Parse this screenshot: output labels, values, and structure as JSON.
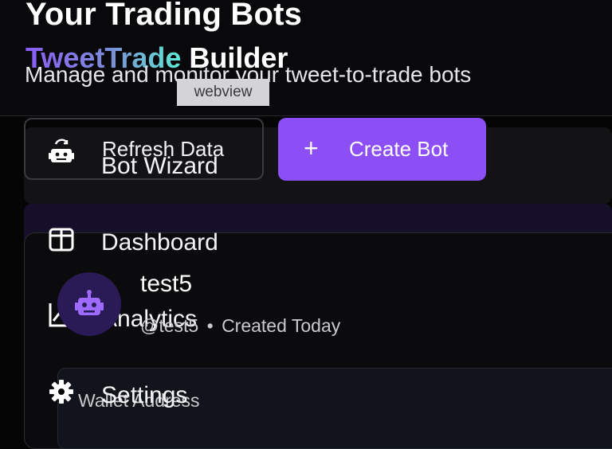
{
  "header": {
    "title": "Your Trading Bots",
    "subtitle": "Manage and monitor your tweet-to-trade bots",
    "brand_part1": "TweetTrade",
    "brand_part2": "Builder"
  },
  "tooltip": "webview",
  "toolbar": {
    "refresh_label": "Refresh Data",
    "create_label": "Create Bot",
    "create_icon": "+"
  },
  "nav": {
    "items": [
      {
        "label": "Bot Wizard",
        "icon": "robot-icon"
      },
      {
        "label": "Dashboard",
        "icon": "dashboard-icon"
      },
      {
        "label": "Analytics",
        "icon": "analytics-icon"
      },
      {
        "label": "Settings",
        "icon": "gear-icon"
      }
    ]
  },
  "bot": {
    "name": "test5",
    "handle": "@test5",
    "separator": "•",
    "created": "Created Today",
    "avatar_icon": "robot-icon"
  },
  "wallet": {
    "label": "Wallet Address"
  },
  "colors": {
    "accent": "#8b4ff5",
    "background": "#050506",
    "brand_gradient_start": "#8b5cf6",
    "brand_gradient_end": "#5eead4"
  }
}
